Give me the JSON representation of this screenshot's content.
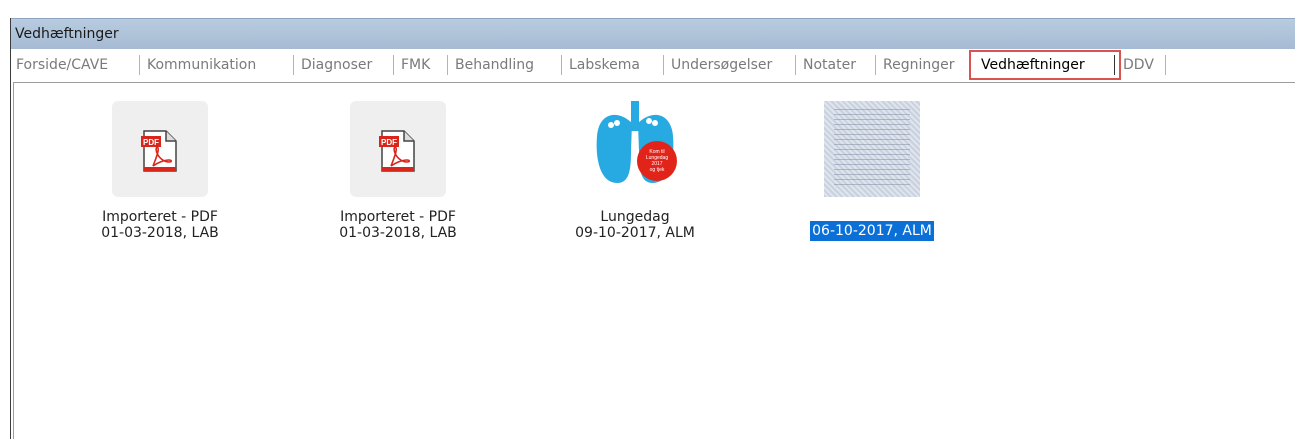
{
  "window": {
    "title": "Vedhæftninger"
  },
  "tabs": [
    {
      "label": "Forside/CAVE"
    },
    {
      "label": "Kommunikation"
    },
    {
      "label": "Diagnoser"
    },
    {
      "label": "FMK"
    },
    {
      "label": "Behandling"
    },
    {
      "label": "Labskema"
    },
    {
      "label": "Undersøgelser"
    },
    {
      "label": "Notater"
    },
    {
      "label": "Regninger"
    },
    {
      "label": "Vedhæftninger",
      "active": true
    },
    {
      "label": "DDV"
    }
  ],
  "attachments": [
    {
      "icon": "pdf-icon",
      "name": "Importeret - PDF",
      "meta": "01-03-2018, LAB"
    },
    {
      "icon": "pdf-icon",
      "name": "Importeret - PDF",
      "meta": "01-03-2018, LAB"
    },
    {
      "icon": "lungs-icon",
      "name": "Lungedag",
      "meta": "09-10-2017, ALM"
    },
    {
      "icon": "scanned-document-icon",
      "name": "",
      "meta": "06-10-2017, ALM",
      "selected": true
    }
  ],
  "colors": {
    "titlebar": "#a6bbd3",
    "selection": "#0b6fd8",
    "active_tab_border": "#d9534f",
    "pdf_red": "#d9261c"
  }
}
